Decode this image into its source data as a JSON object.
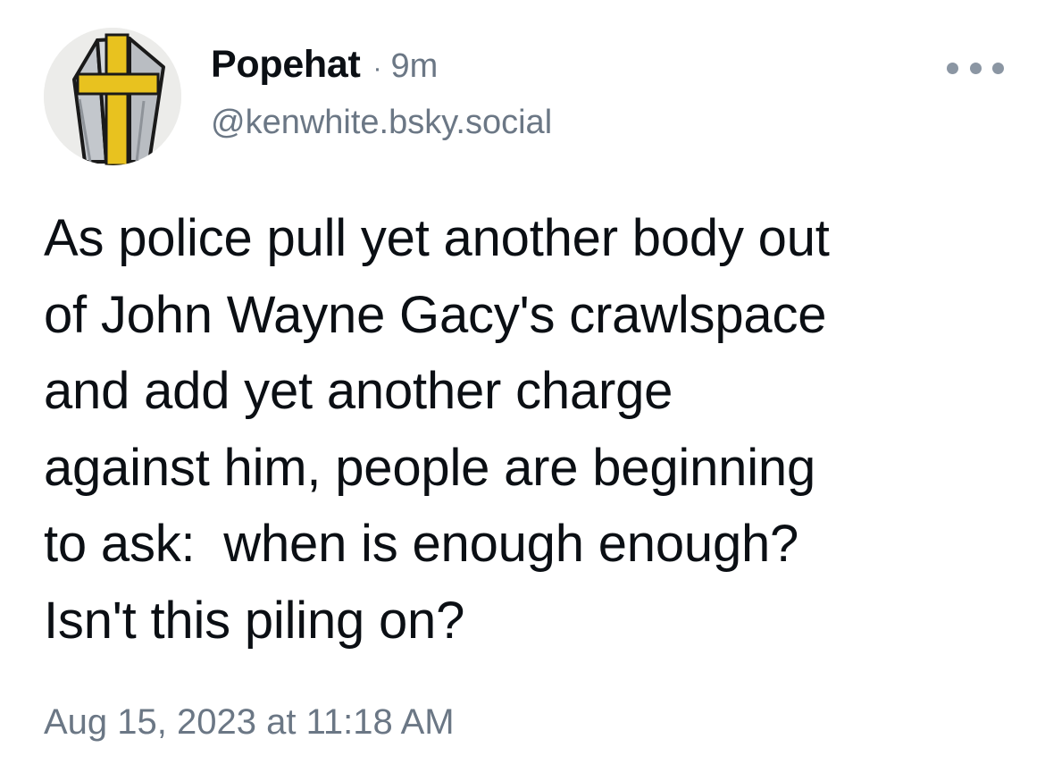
{
  "post": {
    "author": {
      "display_name": "Popehat",
      "handle": "@kenwhite.bsky.social",
      "avatar_icon": "mitre-with-cross-icon"
    },
    "separator": "·",
    "age": "9m",
    "more_icon": "ellipsis-icon",
    "text_lines": [
      "As police pull yet another body out",
      "of John Wayne Gacy's crawlspace",
      "and add yet another charge",
      "against him, people are beginning",
      "to ask:  when is enough enough?",
      "Isn't this piling on?"
    ],
    "timestamp": "Aug 15, 2023 at 11:18 AM"
  },
  "colors": {
    "text_primary": "#0b0f14",
    "text_secondary": "#6b7785",
    "avatar_gold": "#e8c21f",
    "avatar_silver": "#c3c7cc"
  }
}
